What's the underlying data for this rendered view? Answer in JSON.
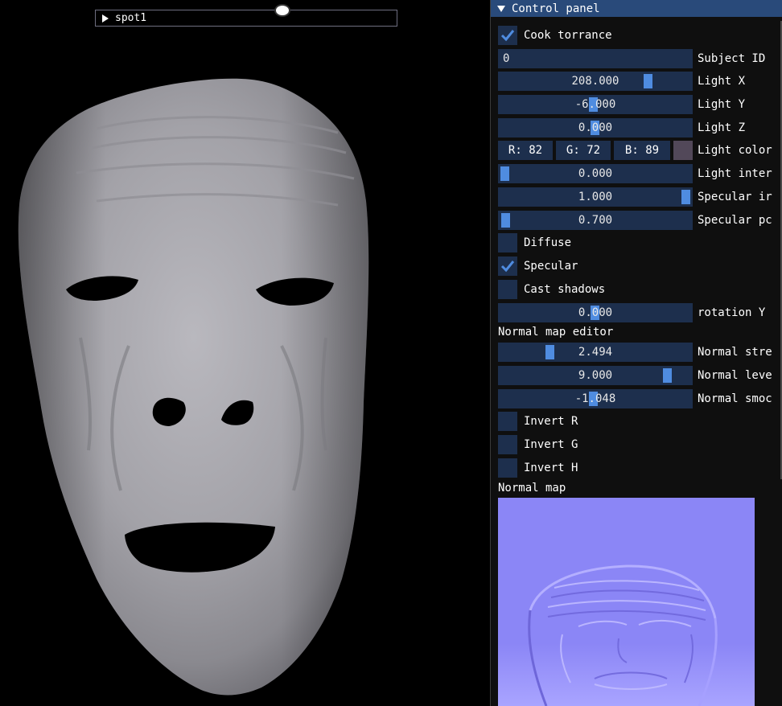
{
  "viewport": {
    "node_label": "spot1"
  },
  "panel": {
    "title": "Control panel",
    "cook_torrance": {
      "label": "Cook torrance",
      "checked": true
    },
    "subject_id": {
      "value": "0",
      "label": "Subject ID"
    },
    "light_x": {
      "value": "208.000",
      "label": "Light X",
      "level": 0.78
    },
    "light_y": {
      "value": "-6.000",
      "label": "Light Y",
      "level": 0.48
    },
    "light_z": {
      "value": "0.000",
      "label": "Light Z",
      "level": 0.5
    },
    "light_color": {
      "r": "R: 82",
      "g": "G: 72",
      "b": "B: 89",
      "label": "Light color",
      "swatch": "#524859"
    },
    "light_intensity": {
      "value": "0.000",
      "label": "Light inter",
      "level": 0.0
    },
    "specular_intensity": {
      "value": "1.000",
      "label": "Specular ir",
      "level": 1.0
    },
    "specular_power": {
      "value": "0.700",
      "label": "Specular pc",
      "level": 0.0
    },
    "diffuse": {
      "label": "Diffuse",
      "checked": false
    },
    "specular": {
      "label": "Specular",
      "checked": true
    },
    "cast_shadows": {
      "label": "Cast shadows",
      "checked": false
    },
    "rotation_y": {
      "value": "0.000",
      "label": "rotation Y",
      "level": 0.5
    },
    "normal_map_editor": "Normal map editor",
    "normal_strength": {
      "value": "2.494",
      "label": "Normal stre",
      "level": 0.27
    },
    "normal_level": {
      "value": "9.000",
      "label": "Normal leve",
      "level": 0.9
    },
    "normal_smooth": {
      "value": "-1.048",
      "label": "Normal smoc",
      "level": 0.48
    },
    "invert_r": {
      "label": "Invert R",
      "checked": false
    },
    "invert_g": {
      "label": "Invert G",
      "checked": false
    },
    "invert_h": {
      "label": "Invert H",
      "checked": false
    },
    "normal_map_label": "Normal map"
  },
  "colors": {
    "panel_bg": "#0f0f0f",
    "frame_bg": "#1d2f4d",
    "title_bg": "#294a7a",
    "accent": "#4f8ce0",
    "normal_map_base": "#8080ff"
  }
}
